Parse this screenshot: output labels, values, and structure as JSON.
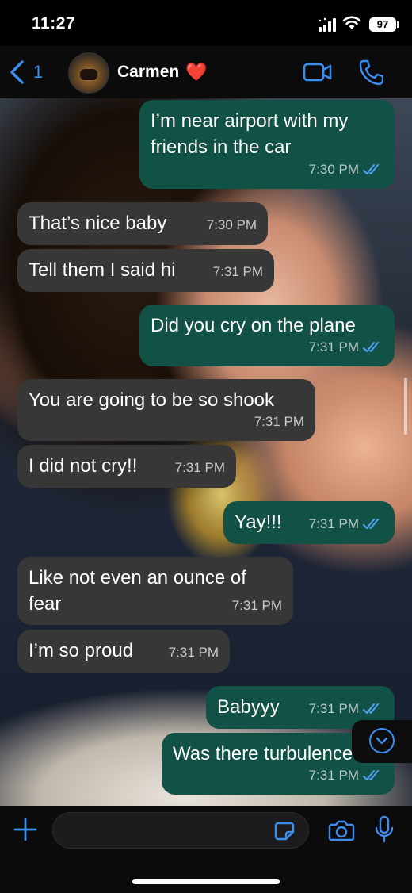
{
  "status": {
    "time": "11:27",
    "battery": "97"
  },
  "header": {
    "back_count": "1",
    "contact_name": "Carmen",
    "contact_emoji": "❤️"
  },
  "messages": [
    {
      "dir": "out",
      "text": "I’m near airport with my friends in the car",
      "time": "7:30 PM",
      "read": true
    },
    {
      "dir": "in",
      "text": "That’s nice baby",
      "time": "7:30 PM"
    },
    {
      "dir": "in",
      "text": "Tell them I said hi",
      "time": "7:31 PM"
    },
    {
      "dir": "out",
      "text": "Did you cry on the plane",
      "time": "7:31 PM",
      "read": true
    },
    {
      "dir": "in",
      "text": "You are going to be so shook",
      "time": "7:31 PM"
    },
    {
      "dir": "in",
      "text": "I did not cry!!",
      "time": "7:31 PM"
    },
    {
      "dir": "out",
      "text": "Yay!!!",
      "time": "7:31 PM",
      "read": true
    },
    {
      "dir": "in",
      "text": "Like not even an ounce of fear",
      "time": "7:31 PM"
    },
    {
      "dir": "in",
      "text": "I’m so proud",
      "time": "7:31 PM"
    },
    {
      "dir": "out",
      "text": "Babyyy",
      "time": "7:31 PM",
      "read": true
    },
    {
      "dir": "out",
      "text": "Was there turbulence",
      "time": "7:31 PM",
      "read": true
    }
  ],
  "input": {
    "value": "",
    "placeholder": ""
  },
  "colors": {
    "accent": "#3d8cf0",
    "outgoing_bubble": "#125145",
    "incoming_bubble": "#373738",
    "read_ticks": "#4fa3f7"
  },
  "icons": [
    "back-chevron-icon",
    "video-call-icon",
    "phone-call-icon",
    "scroll-down-icon",
    "plus-icon",
    "sticker-icon",
    "camera-icon",
    "microphone-icon"
  ]
}
